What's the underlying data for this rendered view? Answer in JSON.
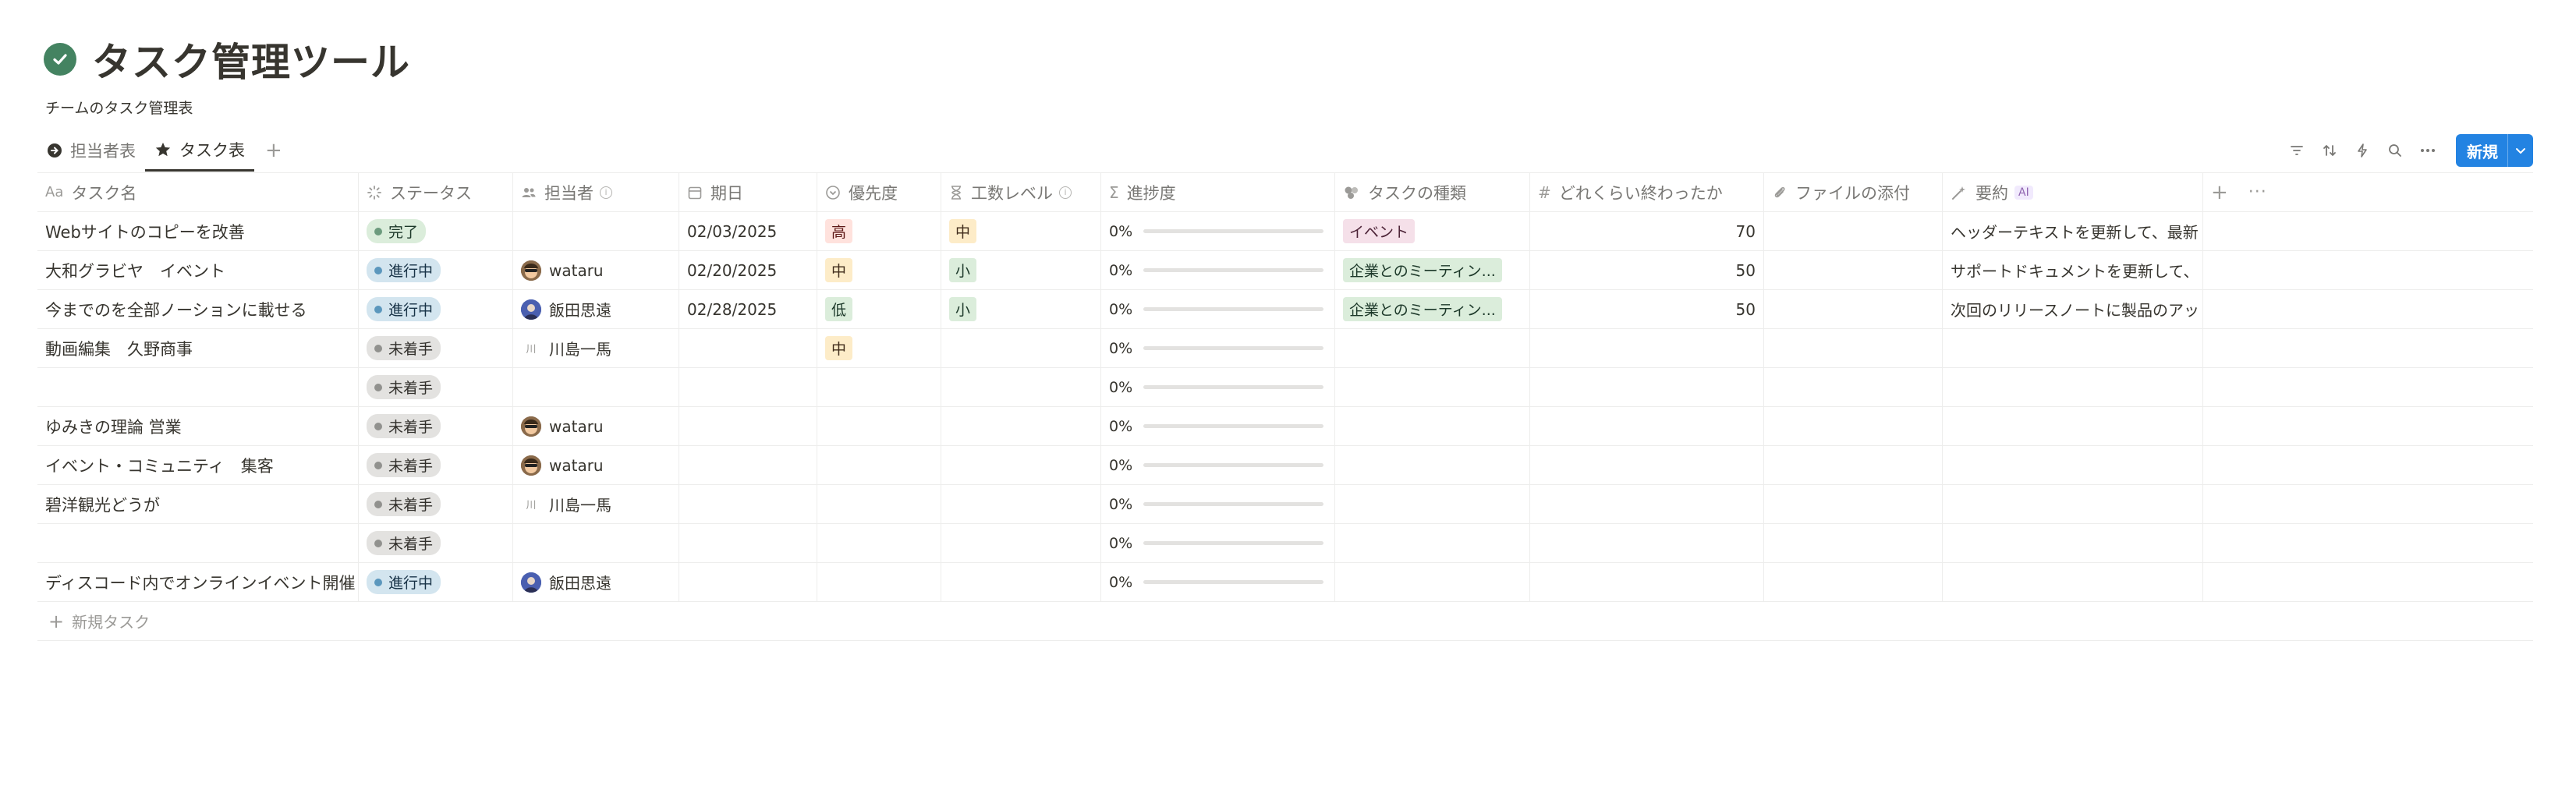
{
  "page": {
    "title": "タスク管理ツール",
    "subtitle": "チームのタスク管理表",
    "title_icon": "check-circle-icon"
  },
  "views": {
    "tabs": [
      {
        "label": "担当者表",
        "icon": "arrow-circle-icon",
        "active": false
      },
      {
        "label": "タスク表",
        "icon": "star-icon",
        "active": true
      }
    ],
    "toolbar": [
      "filter-icon",
      "sort-icon",
      "lightning-icon",
      "search-icon",
      "more-icon"
    ],
    "new_button": "新規"
  },
  "columns": [
    {
      "label": "タスク名",
      "icon": "Aa"
    },
    {
      "label": "ステータス",
      "icon": "status-icon"
    },
    {
      "label": "担当者",
      "icon": "people-icon",
      "info": true
    },
    {
      "label": "期日",
      "icon": "calendar-icon"
    },
    {
      "label": "優先度",
      "icon": "select-icon"
    },
    {
      "label": "工数レベル",
      "icon": "hourglass-icon",
      "info": true
    },
    {
      "label": "進捗度",
      "icon": "sigma-icon"
    },
    {
      "label": "タスクの種類",
      "icon": "multiselect-icon"
    },
    {
      "label": "どれくらい終わったか",
      "icon": "number-icon"
    },
    {
      "label": "ファイルの添付",
      "icon": "paperclip-icon"
    },
    {
      "label": "要約",
      "icon": "ai-wand-icon",
      "badge": "AI"
    }
  ],
  "rows": [
    {
      "name": "Webサイトのコピーを改善",
      "status": "完了",
      "status_kind": "done",
      "assignee": "",
      "due": "02/03/2025",
      "priority": "高",
      "priority_color": "red",
      "effort": "中",
      "effort_color": "yellow",
      "progress": "0%",
      "progress_value": 0,
      "type": "イベント",
      "type_color": "pink",
      "done_amount": "70",
      "summary": "ヘッダーテキストを更新して、最新"
    },
    {
      "name": "大和グラビヤ　イベント",
      "status": "進行中",
      "status_kind": "progress",
      "assignee": "wataru",
      "avatar": "wataru",
      "due": "02/20/2025",
      "priority": "中",
      "priority_color": "yellow",
      "effort": "小",
      "effort_color": "green",
      "progress": "0%",
      "progress_value": 0,
      "type": "企業とのミーティン...",
      "type_color": "green",
      "done_amount": "50",
      "summary": "サポートドキュメントを更新して、"
    },
    {
      "name": "今までのを全部ノーションに載せる",
      "status": "進行中",
      "status_kind": "progress",
      "assignee": "飯田思遠",
      "avatar": "iida",
      "due": "02/28/2025",
      "priority": "低",
      "priority_color": "green",
      "effort": "小",
      "effort_color": "green",
      "progress": "0%",
      "progress_value": 0,
      "type": "企業とのミーティン...",
      "type_color": "green",
      "done_amount": "50",
      "summary": "次回のリリースノートに製品のアッ"
    },
    {
      "name": "動画編集　久野商事",
      "status": "未着手",
      "status_kind": "todo",
      "assignee": "川島一馬",
      "avatar": "kawa",
      "due": "",
      "priority": "中",
      "priority_color": "yellow",
      "effort": "",
      "progress": "0%",
      "progress_value": 0,
      "type": "",
      "done_amount": "",
      "summary": ""
    },
    {
      "name": "",
      "status": "未着手",
      "status_kind": "todo",
      "assignee": "",
      "due": "",
      "priority": "",
      "effort": "",
      "progress": "0%",
      "progress_value": 0,
      "type": "",
      "done_amount": "",
      "summary": ""
    },
    {
      "name": "ゆみきの理論 営業",
      "status": "未着手",
      "status_kind": "todo",
      "assignee": "wataru",
      "avatar": "wataru",
      "due": "",
      "priority": "",
      "effort": "",
      "progress": "0%",
      "progress_value": 0,
      "type": "",
      "done_amount": "",
      "summary": ""
    },
    {
      "name": "イベント・コミュニティ　集客",
      "status": "未着手",
      "status_kind": "todo",
      "assignee": "wataru",
      "avatar": "wataru",
      "due": "",
      "priority": "",
      "effort": "",
      "progress": "0%",
      "progress_value": 0,
      "type": "",
      "done_amount": "",
      "summary": ""
    },
    {
      "name": "碧洋観光どうが",
      "status": "未着手",
      "status_kind": "todo",
      "assignee": "川島一馬",
      "avatar": "kawa",
      "due": "",
      "priority": "",
      "effort": "",
      "progress": "0%",
      "progress_value": 0,
      "type": "",
      "done_amount": "",
      "summary": ""
    },
    {
      "name": "",
      "status": "未着手",
      "status_kind": "todo",
      "assignee": "",
      "due": "",
      "priority": "",
      "effort": "",
      "progress": "0%",
      "progress_value": 0,
      "type": "",
      "done_amount": "",
      "summary": ""
    },
    {
      "name": "ディスコード内でオンラインイベント開催",
      "status": "進行中",
      "status_kind": "progress",
      "assignee": "飯田思遠",
      "avatar": "iida",
      "due": "",
      "priority": "",
      "effort": "",
      "progress": "0%",
      "progress_value": 0,
      "type": "",
      "done_amount": "",
      "summary": ""
    }
  ],
  "add_row_label": "新規タスク",
  "avatar_labels": {
    "kawa": "川"
  }
}
